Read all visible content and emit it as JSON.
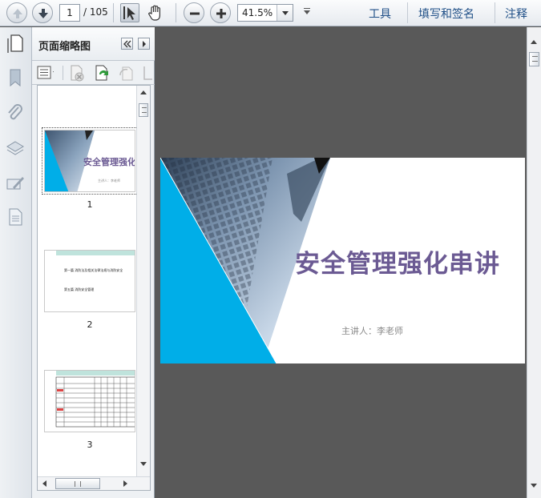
{
  "toolbar": {
    "page_current": "1",
    "page_total": "/ 105",
    "zoom_value": "41.5%",
    "links": {
      "tools": "工具",
      "fill_sign": "填写和签名",
      "comment": "注释"
    }
  },
  "panel": {
    "title": "页面缩略图",
    "thumbnails": [
      {
        "label": "1",
        "title": "安全管理强化串",
        "subtitle": "主讲人：李老师"
      },
      {
        "label": "2",
        "line1": "第一篇  消防法及相关法律法规与消防安全",
        "line2": "第五篇  消防安全管理"
      },
      {
        "label": "3"
      }
    ]
  },
  "slide": {
    "title": "安全管理强化串讲",
    "subtitle": "主讲人：李老师"
  },
  "colors": {
    "title_purple": "#6b5a93",
    "accent_blue": "#00aee8",
    "link_blue": "#1f4f87"
  },
  "icons": {
    "nav": [
      "bookmark-icon",
      "attachment-icon",
      "layers-icon",
      "signature-icon",
      "page-icon"
    ],
    "panel_tools": [
      "options-icon",
      "delete-page-icon",
      "insert-page-icon",
      "rotate-icon",
      "crop-icon"
    ]
  }
}
